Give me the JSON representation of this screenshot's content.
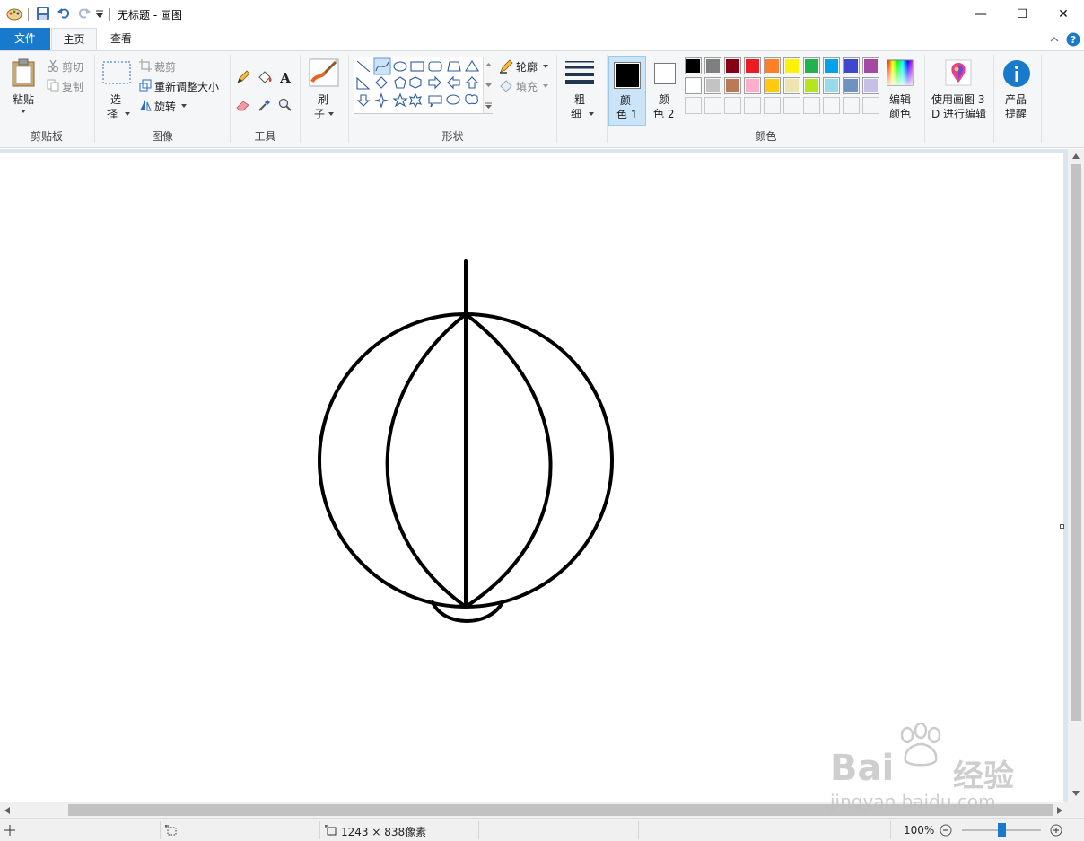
{
  "window": {
    "title": "无标题 - 画图",
    "minimize_glyph": "—",
    "maximize_glyph": "☐",
    "close_glyph": "✕"
  },
  "tabs": {
    "file": "文件",
    "home": "主页",
    "view": "查看"
  },
  "ribbon": {
    "clipboard": {
      "paste": "粘贴",
      "cut": "剪切",
      "copy": "复制",
      "label": "剪贴板"
    },
    "image": {
      "select_1": "选",
      "select_2": "择",
      "crop": "裁剪",
      "resize": "重新调整大小",
      "rotate": "旋转",
      "label": "图像"
    },
    "tools": {
      "label": "工具"
    },
    "brushes": {
      "label_1": "刷",
      "label_2": "子"
    },
    "shapes": {
      "outline": "轮廓",
      "fill": "填充",
      "label": "形状"
    },
    "size": {
      "label_1": "粗",
      "label_2": "细"
    },
    "colors": {
      "color1_1": "颜",
      "color1_2": "色 1",
      "color2_1": "颜",
      "color2_2": "色 2",
      "edit_1": "编辑",
      "edit_2": "颜色",
      "label": "颜色",
      "color1_value": "#000000",
      "color2_value": "#ffffff",
      "palette_row1": [
        "#000000",
        "#7f7f7f",
        "#880015",
        "#ed1c24",
        "#ff7f27",
        "#fff200",
        "#22b14c",
        "#00a2e8",
        "#3f48cc",
        "#a349a4"
      ],
      "palette_row2": [
        "#ffffff",
        "#c3c3c3",
        "#b97a57",
        "#ffaec9",
        "#ffc90e",
        "#efe4b0",
        "#b5e61d",
        "#99d9ea",
        "#7092be",
        "#c8bfe7"
      ],
      "palette_row3": [
        "#f5f6f7",
        "#f5f6f7",
        "#f5f6f7",
        "#f5f6f7",
        "#f5f6f7",
        "#f5f6f7",
        "#f5f6f7",
        "#f5f6f7",
        "#f5f6f7",
        "#f5f6f7"
      ]
    },
    "paint3d": {
      "line1": "使用画图 3",
      "line2": "D 进行编辑"
    },
    "product": {
      "line1": "产品",
      "line2": "提醒"
    }
  },
  "status": {
    "canvas_size": "1243 × 838像素",
    "zoom": "100%",
    "zoom_level": 1.0
  },
  "watermark": {
    "logo": "Bai",
    "brand_cn": "经验",
    "url": "jingyan.baidu.com"
  },
  "colors": {
    "accent": "#1979ca",
    "ribbon_bg": "#f5f6f7",
    "workspace_bg": "#dbe4f1"
  }
}
